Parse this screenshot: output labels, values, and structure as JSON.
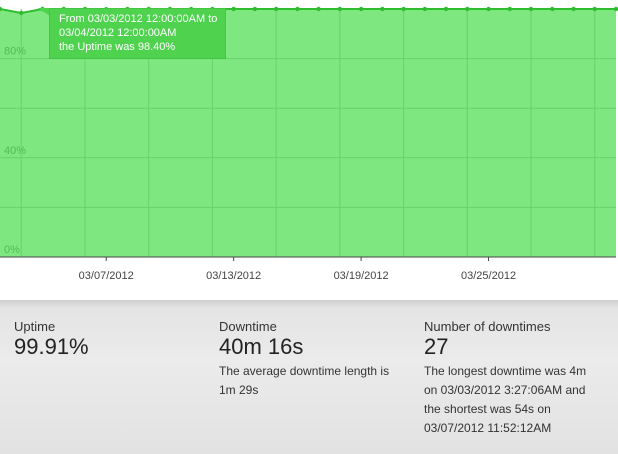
{
  "chart_data": {
    "type": "area",
    "x_ticks": [
      "03/07/2012",
      "03/13/2012",
      "03/19/2012",
      "03/25/2012"
    ],
    "y_ticks": [
      "0%",
      "40%",
      "80%"
    ],
    "ylim": [
      0,
      100
    ],
    "xlim": [
      "03/02/2012",
      "03/31/2012"
    ],
    "x": [
      "03/02/2012",
      "03/03/2012",
      "03/04/2012",
      "03/05/2012",
      "03/06/2012",
      "03/07/2012",
      "03/08/2012",
      "03/09/2012",
      "03/10/2012",
      "03/11/2012",
      "03/12/2012",
      "03/13/2012",
      "03/14/2012",
      "03/15/2012",
      "03/16/2012",
      "03/17/2012",
      "03/18/2012",
      "03/19/2012",
      "03/20/2012",
      "03/21/2012",
      "03/22/2012",
      "03/23/2012",
      "03/24/2012",
      "03/25/2012",
      "03/26/2012",
      "03/27/2012",
      "03/28/2012",
      "03/29/2012",
      "03/30/2012",
      "03/31/2012"
    ],
    "series": [
      {
        "values": [
          100,
          98.4,
          100,
          100,
          100,
          99.9,
          100,
          100,
          100,
          100,
          100,
          100,
          100,
          100,
          100,
          100,
          100,
          100,
          100,
          100,
          100,
          100,
          100,
          100,
          100,
          100,
          100,
          100,
          100,
          100
        ],
        "color": "#2fbd2f"
      }
    ],
    "fill_color": "#7fe77f",
    "grid": true
  },
  "tooltip": {
    "line1": "From 03/03/2012 12:00:00AM to",
    "line2": "03/04/2012 12:00:00AM",
    "line3": "the Uptime was 98.40%"
  },
  "stats": {
    "uptime": {
      "label": "Uptime",
      "value": "99.91%"
    },
    "downtime": {
      "label": "Downtime",
      "value": "40m 16s",
      "note_line1": "The average downtime length is",
      "note_line2": "1m 29s"
    },
    "downtimes": {
      "label": "Number of downtimes",
      "value": "27",
      "note_line1": "The longest downtime was 4m",
      "note_line2": "on 03/03/2012 3:27:06AM and",
      "note_line3": "the shortest was 54s on",
      "note_line4": "03/07/2012 11:52:12AM"
    }
  },
  "colors": {
    "plot_fill": "#7fe77f",
    "line": "#2fbd2f",
    "tooltip_bg": "#4fd34f",
    "grid": "#6ad16a"
  }
}
